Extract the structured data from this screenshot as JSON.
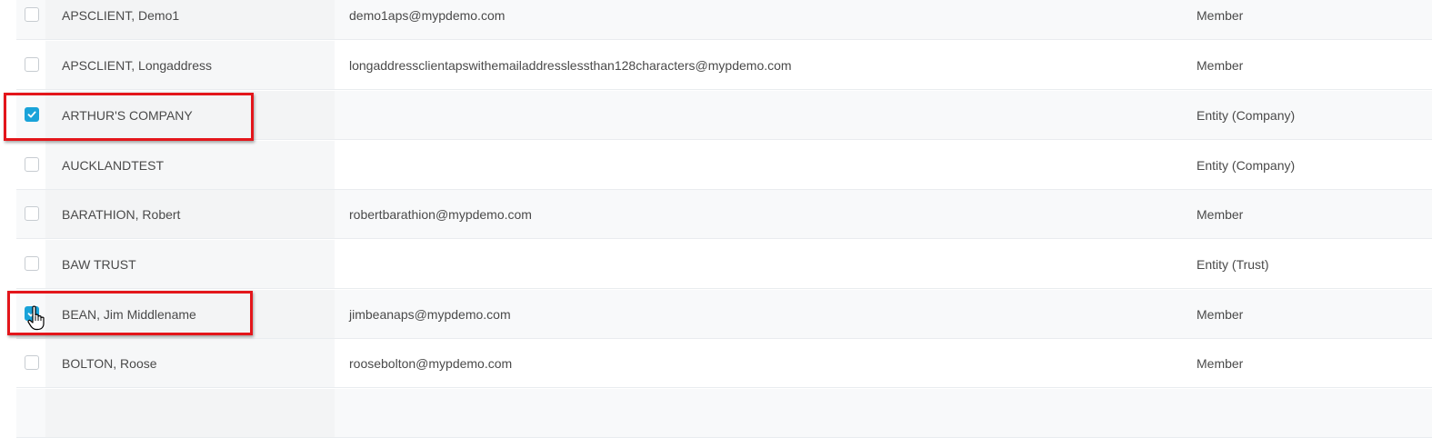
{
  "rows": [
    {
      "name": "APSCLIENT, Demo1",
      "email": "demo1aps@mypdemo.com",
      "type": "Member",
      "checked": false
    },
    {
      "name": "APSCLIENT, Longaddress",
      "email": "longaddressclientapswithemailaddresslessthan128characters@mypdemo.com",
      "type": "Member",
      "checked": false
    },
    {
      "name": "ARTHUR'S COMPANY",
      "email": "",
      "type": "Entity (Company)",
      "checked": true
    },
    {
      "name": "AUCKLANDTEST",
      "email": "",
      "type": "Entity (Company)",
      "checked": false
    },
    {
      "name": "BARATHION, Robert",
      "email": "robertbarathion@mypdemo.com",
      "type": "Member",
      "checked": false
    },
    {
      "name": "BAW TRUST",
      "email": "",
      "type": "Entity (Trust)",
      "checked": false
    },
    {
      "name": "BEAN, Jim Middlename",
      "email": "jimbeanaps@mypdemo.com",
      "type": "Member",
      "checked": true
    },
    {
      "name": "BOLTON, Roose",
      "email": "roosebolton@mypdemo.com",
      "type": "Member",
      "checked": false
    }
  ],
  "colors": {
    "checkbox_checked": "#1aa3d9",
    "highlight_border": "#e3161b"
  },
  "icons": {
    "checkmark": "check-icon",
    "cursor": "hand-pointer-icon"
  }
}
